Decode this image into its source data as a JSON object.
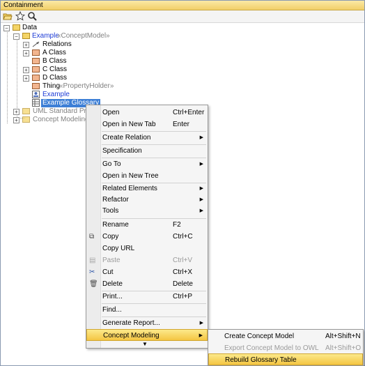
{
  "panel": {
    "title": "Containment"
  },
  "toolbar": {
    "icons": [
      "open-folder-icon",
      "star-icon",
      "search-icon"
    ]
  },
  "tree": {
    "root": "Data",
    "example": {
      "name": "Example",
      "stereotype": "«ConceptModel»"
    },
    "items": [
      {
        "name": "Relations"
      },
      {
        "name": "A Class"
      },
      {
        "name": "B Class"
      },
      {
        "name": "C Class"
      },
      {
        "name": "D Class"
      },
      {
        "name": "Thing",
        "stereotype": "«PropertyHolder»"
      },
      {
        "name": "Example"
      },
      {
        "name": "Example Glossary"
      }
    ],
    "profiles": [
      {
        "name": "UML Standard Profile"
      },
      {
        "name": "Concept Modeling Pr"
      }
    ]
  },
  "context_menu": {
    "items": [
      {
        "label": "Open",
        "shortcut": "Ctrl+Enter"
      },
      {
        "label": "Open in New Tab",
        "shortcut": "Enter"
      },
      {
        "label": "Create Relation"
      },
      {
        "label": "Specification"
      },
      {
        "label": "Go To"
      },
      {
        "label": "Open in New Tree"
      },
      {
        "label": "Related Elements"
      },
      {
        "label": "Refactor"
      },
      {
        "label": "Tools"
      },
      {
        "label": "Rename",
        "shortcut": "F2"
      },
      {
        "label": "Copy",
        "shortcut": "Ctrl+C"
      },
      {
        "label": "Copy URL"
      },
      {
        "label": "Paste",
        "shortcut": "Ctrl+V"
      },
      {
        "label": "Cut",
        "shortcut": "Ctrl+X"
      },
      {
        "label": "Delete",
        "shortcut": "Delete"
      },
      {
        "label": "Print...",
        "shortcut": "Ctrl+P"
      },
      {
        "label": "Find..."
      },
      {
        "label": "Generate Report..."
      },
      {
        "label": "Concept Modeling"
      }
    ]
  },
  "submenu": {
    "items": [
      {
        "label": "Create Concept Model",
        "shortcut": "Alt+Shift+N"
      },
      {
        "label": "Export Concept Model to OWL",
        "shortcut": "Alt+Shift+O"
      },
      {
        "label": "Rebuild Glossary Table"
      }
    ]
  }
}
